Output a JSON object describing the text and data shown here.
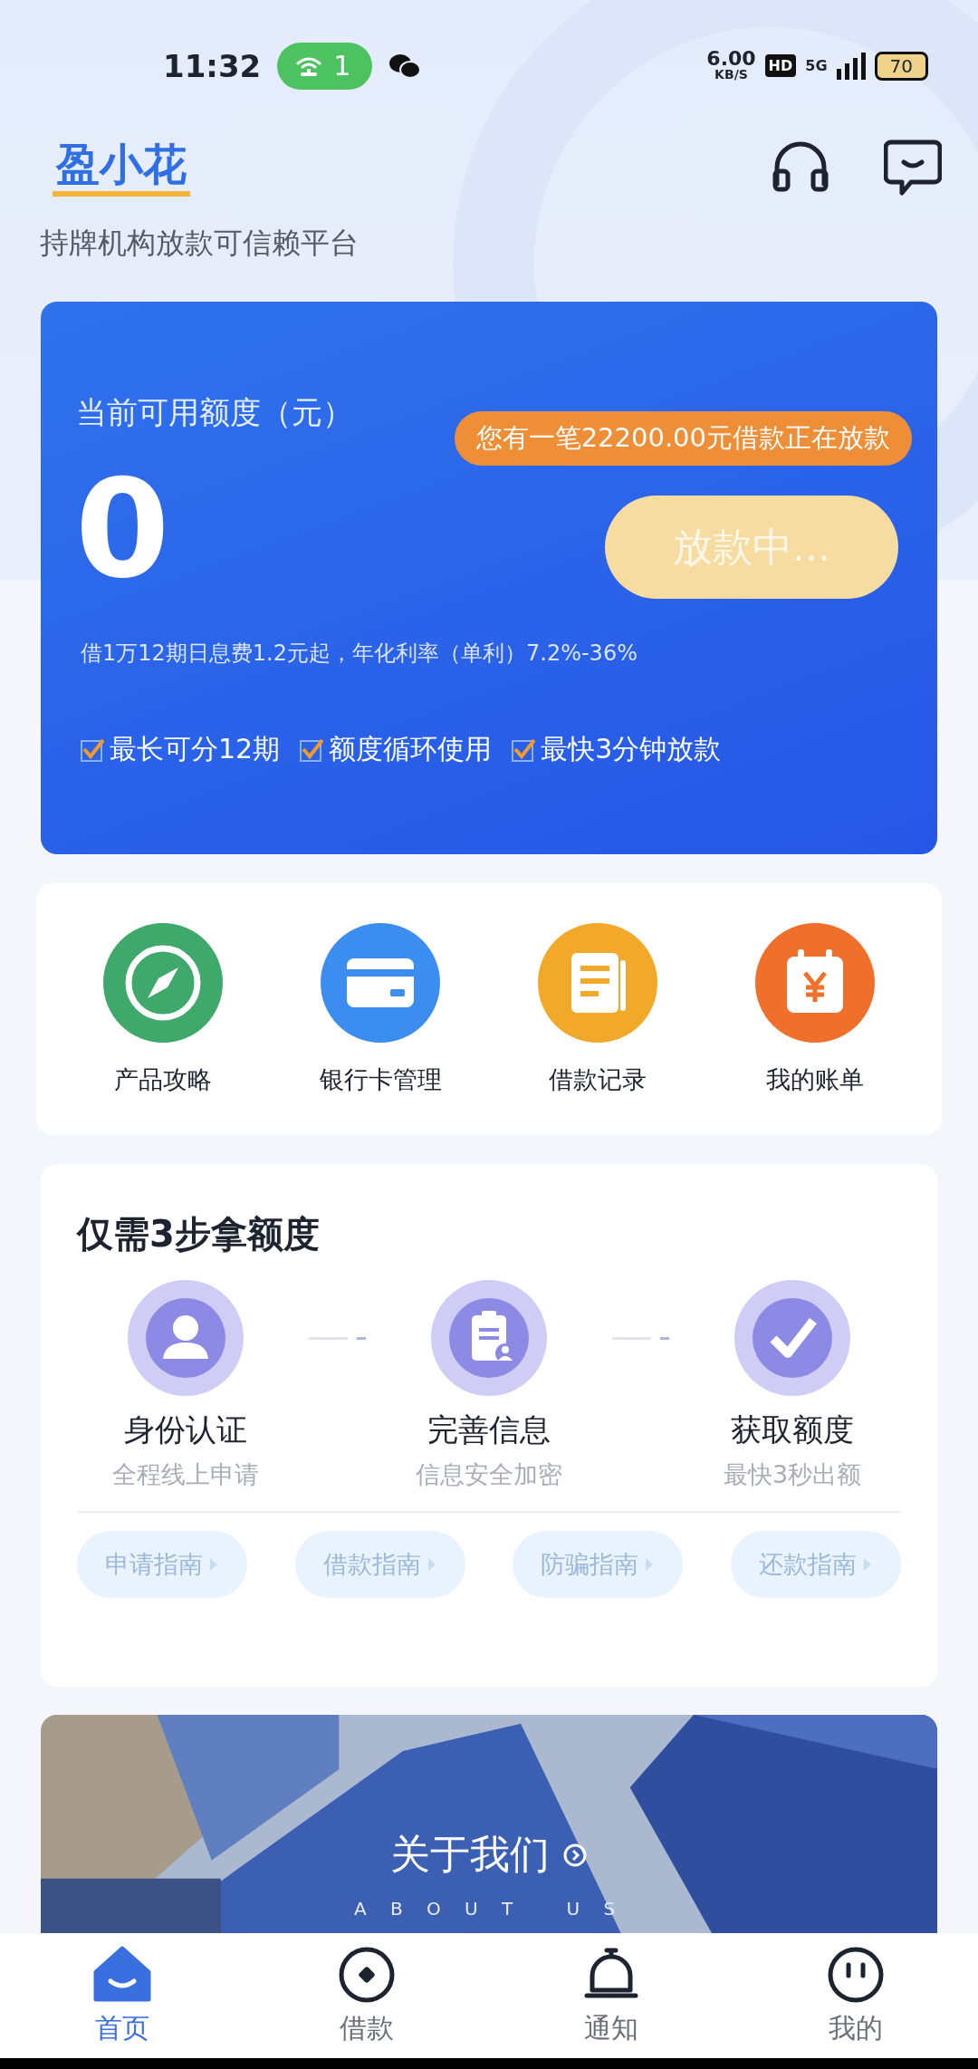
{
  "status_bar": {
    "time": "11:32",
    "hotspot_count": "1",
    "net_speed": "6.00",
    "net_unit": "KB/S",
    "hd": "HD",
    "network": "5G",
    "battery": "70"
  },
  "header": {
    "logo": "盈小花",
    "tagline": "持牌机构放款可信赖平台"
  },
  "credit_card": {
    "label": "当前可用额度（元）",
    "amount": "0",
    "tooltip": "您有一笔22200.00元借款正在放款",
    "button": "放款中...",
    "rate_note": "借1万12期日息费1.2元起，年化利率（单利）7.2%-36%",
    "features": [
      {
        "label": "最长可分12期",
        "checked": true
      },
      {
        "label": "额度循环使用",
        "checked": true
      },
      {
        "label": "最快3分钟放款",
        "checked": true
      }
    ]
  },
  "quick_links": [
    {
      "label": "产品攻略",
      "kind": "compass",
      "color": "#3fa86b"
    },
    {
      "label": "银行卡管理",
      "kind": "card",
      "color": "#3b8ef0"
    },
    {
      "label": "借款记录",
      "kind": "document",
      "color": "#f2a92a"
    },
    {
      "label": "我的账单",
      "kind": "bill",
      "color": "#f06f2a"
    }
  ],
  "steps": {
    "title": "仅需3步拿额度",
    "items": [
      {
        "title": "身份认证",
        "subtitle": "全程线上申请",
        "kind": "person"
      },
      {
        "title": "完善信息",
        "subtitle": "信息安全加密",
        "kind": "clipboard"
      },
      {
        "title": "获取额度",
        "subtitle": "最快3秒出额",
        "kind": "check"
      }
    ],
    "guides": [
      "申请指南",
      "借款指南",
      "防骗指南",
      "还款指南"
    ]
  },
  "banner": {
    "title": "关于我们",
    "subtitle": "A B O U T   U S"
  },
  "tab_bar": [
    {
      "label": "首页",
      "kind": "home",
      "selected": true
    },
    {
      "label": "借款",
      "kind": "loan",
      "selected": false
    },
    {
      "label": "通知",
      "kind": "bell",
      "selected": false
    },
    {
      "label": "我的",
      "kind": "face",
      "selected": false
    }
  ]
}
